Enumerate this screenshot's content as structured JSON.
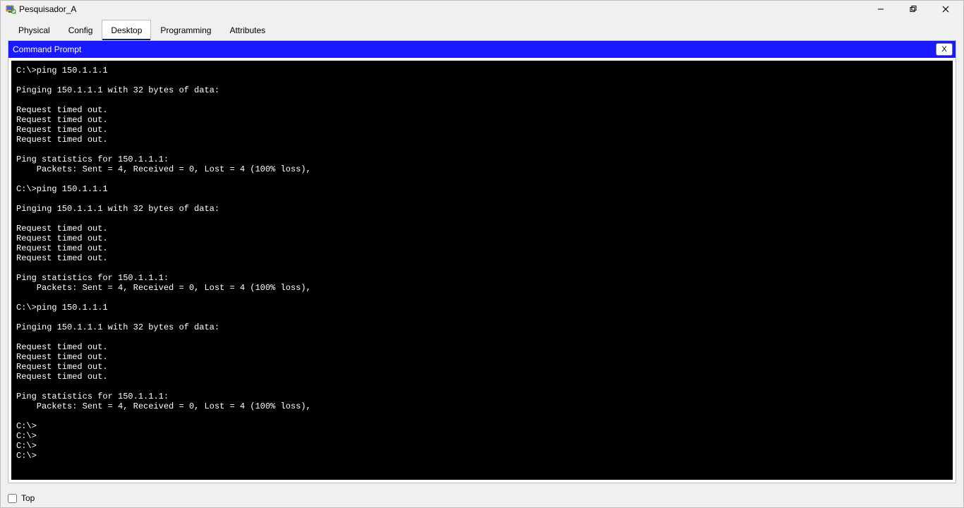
{
  "window": {
    "title": "Pesquisador_A"
  },
  "tabs": {
    "items": [
      {
        "label": "Physical"
      },
      {
        "label": "Config"
      },
      {
        "label": "Desktop"
      },
      {
        "label": "Programming"
      },
      {
        "label": "Attributes"
      }
    ],
    "active_index": 2
  },
  "panel": {
    "title": "Command Prompt",
    "close_label": "X"
  },
  "terminal": {
    "lines": [
      "C:\\>ping 150.1.1.1",
      "",
      "Pinging 150.1.1.1 with 32 bytes of data:",
      "",
      "Request timed out.",
      "Request timed out.",
      "Request timed out.",
      "Request timed out.",
      "",
      "Ping statistics for 150.1.1.1:",
      "    Packets: Sent = 4, Received = 0, Lost = 4 (100% loss),",
      "",
      "C:\\>ping 150.1.1.1",
      "",
      "Pinging 150.1.1.1 with 32 bytes of data:",
      "",
      "Request timed out.",
      "Request timed out.",
      "Request timed out.",
      "Request timed out.",
      "",
      "Ping statistics for 150.1.1.1:",
      "    Packets: Sent = 4, Received = 0, Lost = 4 (100% loss),",
      "",
      "C:\\>ping 150.1.1.1",
      "",
      "Pinging 150.1.1.1 with 32 bytes of data:",
      "",
      "Request timed out.",
      "Request timed out.",
      "Request timed out.",
      "Request timed out.",
      "",
      "Ping statistics for 150.1.1.1:",
      "    Packets: Sent = 4, Received = 0, Lost = 4 (100% loss),",
      "",
      "C:\\>",
      "C:\\>",
      "C:\\>",
      "C:\\>"
    ]
  },
  "footer": {
    "top_label": "Top",
    "top_checked": false
  }
}
